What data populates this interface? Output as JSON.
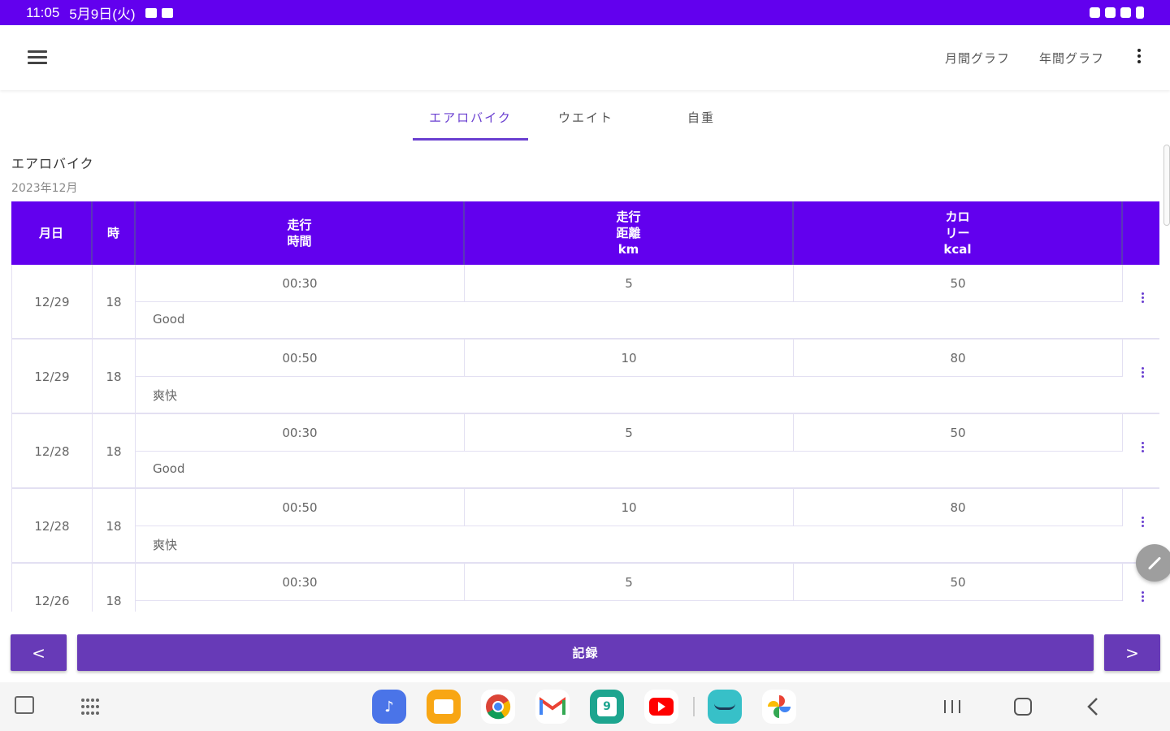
{
  "status_bar": {
    "time": "11:05",
    "date": "5月9日(火)"
  },
  "app_bar": {
    "menu_icon": "hamburger-menu-icon",
    "actions": [
      "月間グラフ",
      "年間グラフ"
    ],
    "overflow_icon": "more-vert-icon"
  },
  "tabs": [
    {
      "label": "エアロバイク",
      "active": true
    },
    {
      "label": "ウエイト",
      "active": false
    },
    {
      "label": "自重",
      "active": false
    }
  ],
  "section": {
    "title": "エアロバイク",
    "month": "2023年12月"
  },
  "table": {
    "header_color": "#6200ee",
    "columns": [
      "月日",
      "時",
      "走行\n時間",
      "走行\n距離\nkm",
      "カロ\nリー\nkcal"
    ],
    "rows": [
      {
        "date": "12/29",
        "hour": "18",
        "time": "00:30",
        "distance": "5",
        "calories": "50",
        "note": "Good"
      },
      {
        "date": "12/29",
        "hour": "18",
        "time": "00:50",
        "distance": "10",
        "calories": "80",
        "note": "爽快"
      },
      {
        "date": "12/28",
        "hour": "18",
        "time": "00:30",
        "distance": "5",
        "calories": "50",
        "note": "Good"
      },
      {
        "date": "12/28",
        "hour": "18",
        "time": "00:50",
        "distance": "10",
        "calories": "80",
        "note": "爽快"
      },
      {
        "date": "12/26",
        "hour": "18",
        "time": "00:30",
        "distance": "5",
        "calories": "50",
        "note": ""
      }
    ]
  },
  "buttons": {
    "prev": "<",
    "record": "記録",
    "next": ">"
  },
  "accent_color": "#673ab7",
  "fab_icon": "edit-icon",
  "dock": {
    "apps": [
      "music-app-icon",
      "files-app-icon",
      "chrome-app-icon",
      "gmail-app-icon",
      "calendar-app-icon",
      "youtube-app-icon",
      "amazon-app-icon",
      "photos-app-icon"
    ],
    "calendar_day": "9"
  }
}
